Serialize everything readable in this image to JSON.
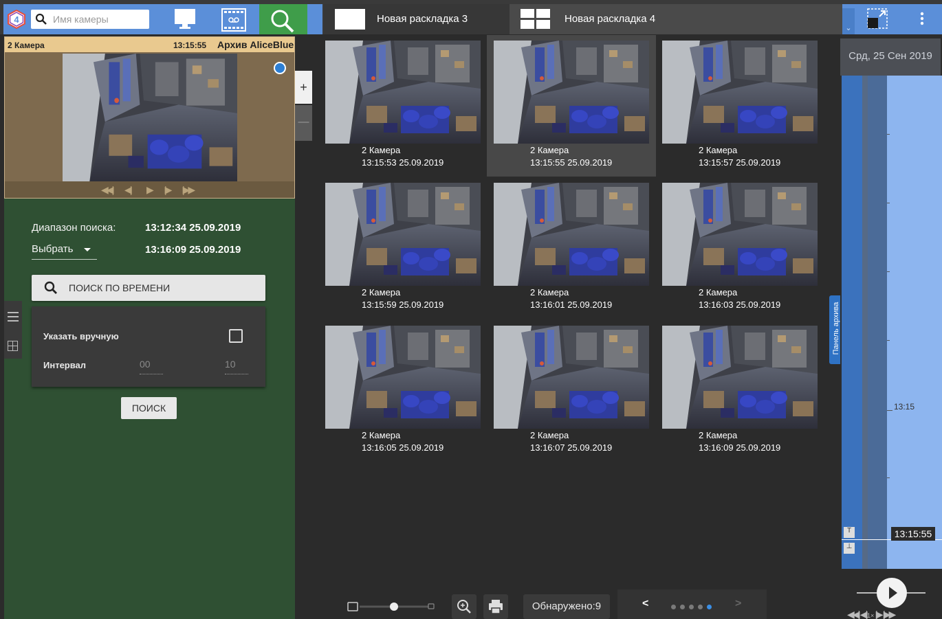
{
  "topbar": {
    "search_placeholder": "Имя камеры",
    "tabs": [
      {
        "label": "Новая раскладка 3"
      },
      {
        "label": "Новая раскладка 4"
      }
    ]
  },
  "camera_tile": {
    "name": "2 Камера",
    "time": "13:15:55",
    "archive": "Архив AliceBlue"
  },
  "search_panel": {
    "range_label": "Диапазон поиска:",
    "range_start": "13:12:34 25.09.2019",
    "select_label": "Выбрать",
    "range_end": "13:16:09 25.09.2019",
    "time_search_button": "ПОИСК ПО ВРЕМЕНИ",
    "manual_label": "Указать вручную",
    "manual_checked": false,
    "interval_label": "Интервал",
    "interval_from": "00",
    "interval_to": "10",
    "search_button": "ПОИСК"
  },
  "results": [
    {
      "camera": "2 Камера",
      "time": "13:15:53 25.09.2019",
      "selected": false
    },
    {
      "camera": "2 Камера",
      "time": "13:15:55 25.09.2019",
      "selected": true
    },
    {
      "camera": "2 Камера",
      "time": "13:15:57 25.09.2019",
      "selected": false
    },
    {
      "camera": "2 Камера",
      "time": "13:15:59 25.09.2019",
      "selected": false
    },
    {
      "camera": "2 Камера",
      "time": "13:16:01 25.09.2019",
      "selected": false
    },
    {
      "camera": "2 Камера",
      "time": "13:16:03 25.09.2019",
      "selected": false
    },
    {
      "camera": "2 Камера",
      "time": "13:16:05 25.09.2019",
      "selected": false
    },
    {
      "camera": "2 Камера",
      "time": "13:16:07 25.09.2019",
      "selected": false
    },
    {
      "camera": "2 Камера",
      "time": "13:16:09 25.09.2019",
      "selected": false
    }
  ],
  "bottom_bar": {
    "found": "Обнаружено:9",
    "pages": 5,
    "current_page": 5
  },
  "archive_tab": "Панель архива",
  "timeline": {
    "date": "Срд, 25 Сен 2019",
    "tick_label": "13:15",
    "current_time": "13:15:55",
    "top_marker": "T",
    "bottom_marker": "⊥",
    "speed": "1×"
  },
  "colors": {
    "accent_blue": "#5b8fd9",
    "search_green": "#3f9d4a",
    "panel_green": "#2f5033",
    "camera_header": "#e9c98f",
    "page_dot_active": "#3b8fe6"
  },
  "icons": {
    "logo": "hexagon-logo-icon",
    "monitor": "monitor-icon",
    "archive": "archive-icon",
    "search": "search-icon",
    "layout": "layout-icon",
    "more": "more-vert-icon"
  }
}
